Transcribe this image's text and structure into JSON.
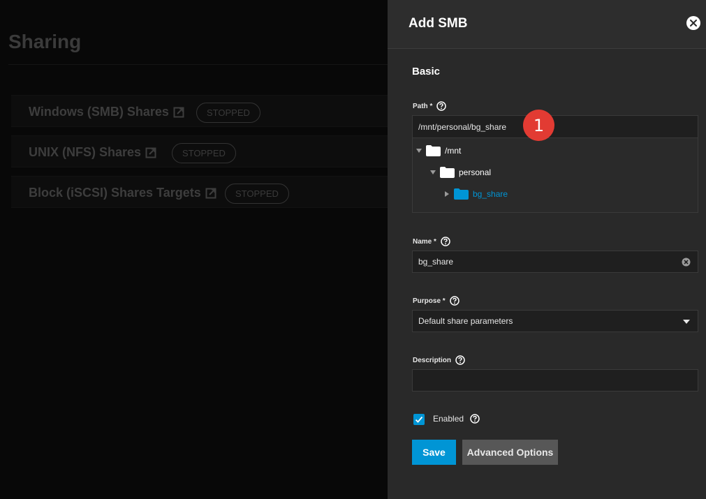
{
  "background": {
    "page_title": "Sharing",
    "cards": [
      {
        "label": "Windows (SMB) Shares",
        "status": "STOPPED"
      },
      {
        "label": "UNIX (NFS) Shares",
        "status": "STOPPED"
      },
      {
        "label": "Block (iSCSI) Shares Targets",
        "status": "STOPPED"
      }
    ]
  },
  "panel": {
    "title": "Add SMB",
    "section": "Basic",
    "path": {
      "label": "Path *",
      "value": "/mnt/personal/bg_share",
      "tree": [
        {
          "name": "/mnt",
          "expanded": true,
          "selected": false
        },
        {
          "name": "personal",
          "expanded": true,
          "selected": false
        },
        {
          "name": "bg_share",
          "expanded": false,
          "selected": true
        }
      ]
    },
    "annotation": "1",
    "name": {
      "label": "Name *",
      "value": "bg_share"
    },
    "purpose": {
      "label": "Purpose *",
      "value": "Default share parameters"
    },
    "description": {
      "label": "Description",
      "value": ""
    },
    "enabled": {
      "label": "Enabled",
      "checked": true
    },
    "buttons": {
      "save": "Save",
      "advanced": "Advanced Options"
    }
  },
  "colors": {
    "accent": "#0095d5",
    "annotation": "#e23b33",
    "selected_folder": "#0095d5"
  }
}
